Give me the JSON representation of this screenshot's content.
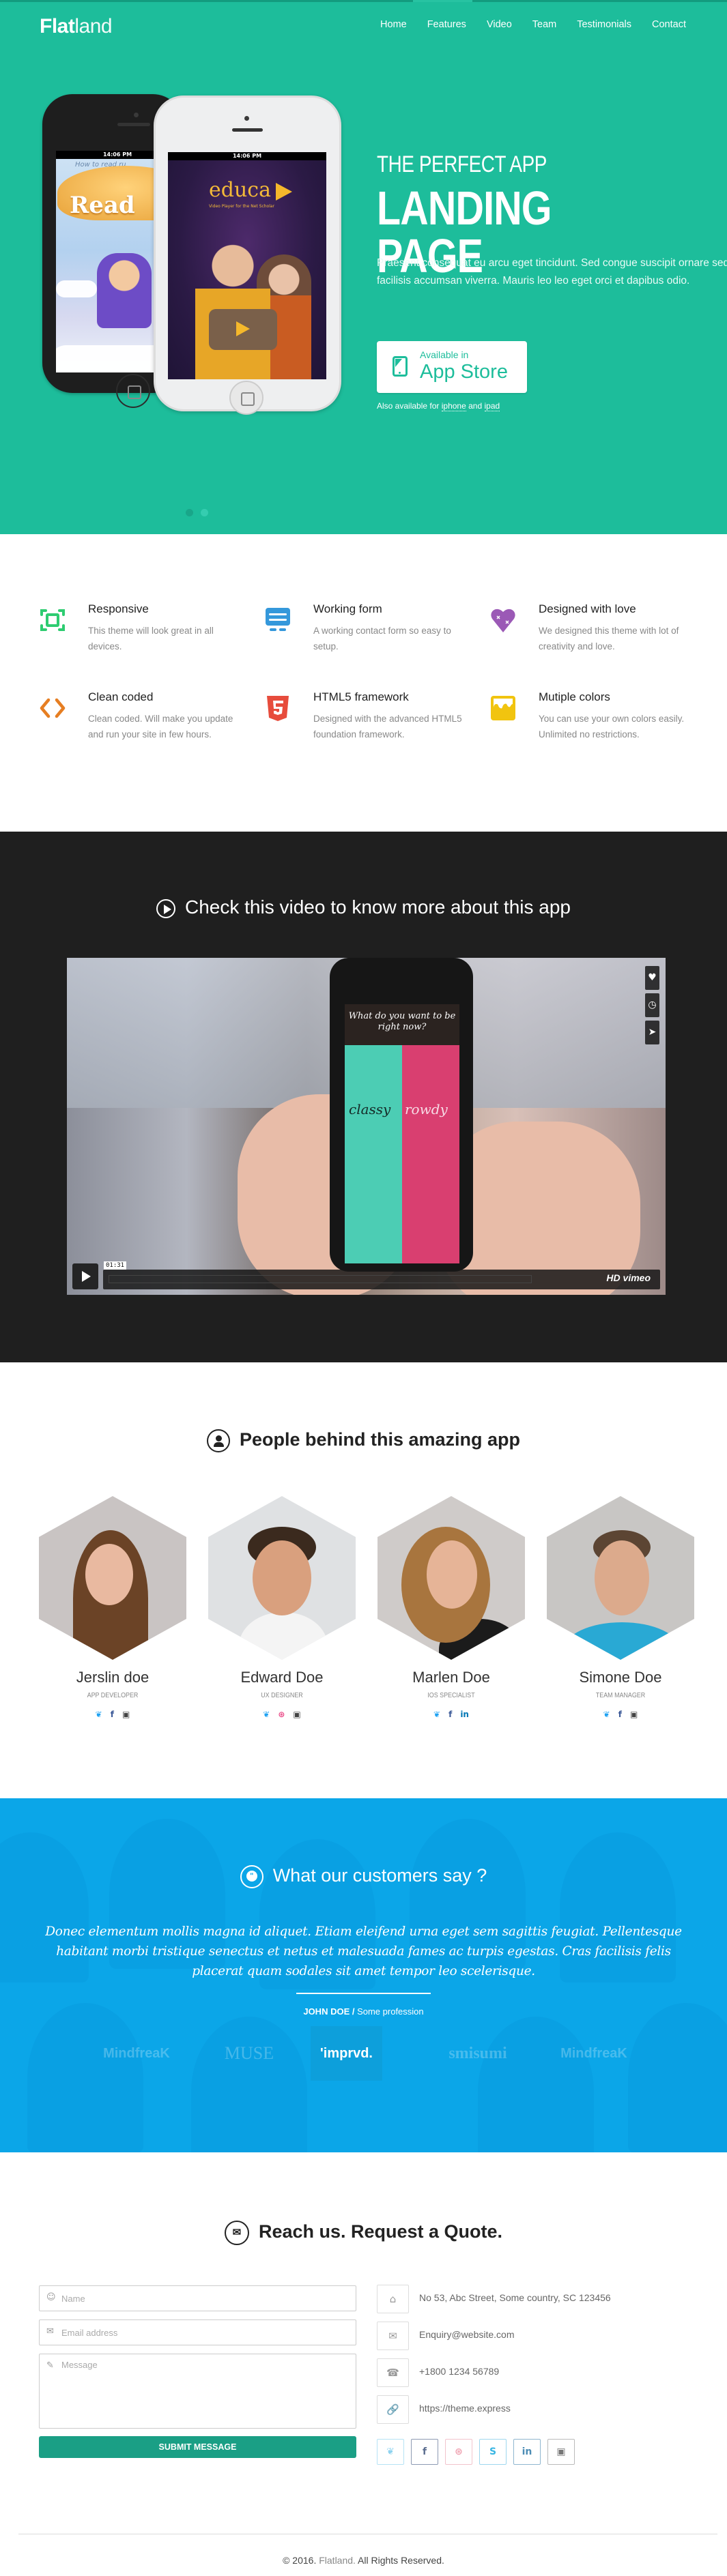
{
  "brand": {
    "bold": "Flat",
    "light": "land"
  },
  "nav": [
    {
      "label": "Home"
    },
    {
      "label": "Features"
    },
    {
      "label": "Video"
    },
    {
      "label": "Team"
    },
    {
      "label": "Testimonials"
    },
    {
      "label": "Contact"
    }
  ],
  "colors": {
    "primary": "#1dbd9b",
    "dark_section": "#1f1f1f",
    "testimonial_blue": "#0ba6e8",
    "submit": "#1a9f85"
  },
  "hero": {
    "subtitle": "THE PERFECT APP",
    "title": "LANDING PAGE",
    "text": "Praesent consequat eu arcu eget tincidunt. Sed congue suscipit ornare sed facilisis accumsan viverra. Mauris leo leo eget orci et dapibus odio.",
    "appstore_small": "Available in",
    "appstore_big": "App Store",
    "also_prefix": "Also available for",
    "also_link1": "iphone",
    "also_mid": "and",
    "also_link2": "ipad",
    "phone_time": "14:06 PM",
    "phone_left_hint": "How to read ru",
    "phone_left_title": "Read",
    "phone_right_title": "educa",
    "phone_right_sub": "Video Player for the Net Scholar",
    "slider": {
      "count": 2,
      "active": 2
    }
  },
  "features": [
    {
      "icon": "responsive-icon",
      "color": "#2ecc71",
      "title": "Responsive",
      "text": "This theme will look great in all devices."
    },
    {
      "icon": "form-icon",
      "color": "#3498db",
      "title": "Working form",
      "text": "A working contact form so easy to setup."
    },
    {
      "icon": "heart-icon",
      "color": "#9b59b6",
      "title": "Designed with love",
      "text": "We designed this theme with lot of creativity and love."
    },
    {
      "icon": "code-icon",
      "color": "#e67e22",
      "title": "Clean coded",
      "text": "Clean coded. Will make you update and run your site in few hours."
    },
    {
      "icon": "html5-icon",
      "color": "#e74c3c",
      "title": "HTML5 framework",
      "text": "Designed with the advanced HTML5 foundation framework."
    },
    {
      "icon": "paint-icon",
      "color": "#f1c40f",
      "title": "Mutiple colors",
      "text": "You can use your own colors easily. Unlimited no restrictions."
    }
  ],
  "video": {
    "heading": "Check this video to know more about this app",
    "question": "What do you want to be right now?",
    "left_option": "classy",
    "right_option": "rowdy",
    "time": "01:31",
    "brand": "HD vimeo",
    "side_buttons": [
      {
        "icon": "heart-icon",
        "glyph": "♥"
      },
      {
        "icon": "clock-icon",
        "glyph": "◷"
      },
      {
        "icon": "send-icon",
        "glyph": "➤"
      }
    ]
  },
  "team": {
    "heading": "People behind this amazing app",
    "members": [
      {
        "name": "Jerslin doe",
        "role": "APP DEVELOPER",
        "social": [
          {
            "icon": "twitter-icon",
            "glyph": "🐦",
            "color": "#1da1f2"
          },
          {
            "icon": "facebook-icon",
            "glyph": "f",
            "color": "#3b5998"
          },
          {
            "icon": "instagram-icon",
            "glyph": "▣",
            "color": "#444"
          }
        ],
        "bg": "#c9c4c3",
        "skin": "#e9b9a0",
        "hair": "#6b4326",
        "shirt": "#8c8a88"
      },
      {
        "name": "Edward Doe",
        "role": "UX DESIGNER",
        "social": [
          {
            "icon": "twitter-icon",
            "glyph": "🐦",
            "color": "#1da1f2"
          },
          {
            "icon": "dribbble-icon",
            "glyph": "⊛",
            "color": "#ea4c89"
          },
          {
            "icon": "instagram-icon",
            "glyph": "▣",
            "color": "#444"
          }
        ],
        "bg": "#dfe1e3",
        "skin": "#d9a07e",
        "hair": "#3b2a1e",
        "shirt": "#f4f4f4"
      },
      {
        "name": "Marlen Doe",
        "role": "IOS SPECIALIST",
        "social": [
          {
            "icon": "twitter-icon",
            "glyph": "🐦",
            "color": "#1da1f2"
          },
          {
            "icon": "facebook-icon",
            "glyph": "f",
            "color": "#3b5998"
          },
          {
            "icon": "linkedin-icon",
            "glyph": "in",
            "color": "#0077b5"
          }
        ],
        "bg": "#cfcbc9",
        "skin": "#e6b497",
        "hair": "#a8753e",
        "shirt": "#1b1b1b"
      },
      {
        "name": "Simone Doe",
        "role": "TEAM MANAGER",
        "social": [
          {
            "icon": "twitter-icon",
            "glyph": "🐦",
            "color": "#1da1f2"
          },
          {
            "icon": "facebook-icon",
            "glyph": "f",
            "color": "#3b5998"
          },
          {
            "icon": "instagram-icon",
            "glyph": "▣",
            "color": "#444"
          }
        ],
        "bg": "#c8c6c4",
        "skin": "#dcaa8c",
        "hair": "#5c4533",
        "shirt": "#29a9d4"
      }
    ]
  },
  "testimonials": {
    "heading": "What our customers say ?",
    "quote": "Donec elementum mollis magna id aliquet. Etiam eleifend urna eget sem sagittis feugiat. Pellentesque habitant morbi tristique senectus et netus et malesuada fames ac turpis egestas. Cras facilisis felis placerat quam sodales sit amet tempor leo scelerisque.",
    "author": "JOHN DOE /",
    "profession": " Some profession",
    "logos": [
      {
        "label": "MindfreaK",
        "active": false
      },
      {
        "label": "MUSE",
        "active": false
      },
      {
        "label": "'imprvd.",
        "active": true
      },
      {
        "label": "smisumi",
        "active": false
      },
      {
        "label": "MindfreaK",
        "active": false
      }
    ]
  },
  "contact": {
    "heading": "Reach us. Request a Quote.",
    "name_placeholder": "Name",
    "email_placeholder": "Email address",
    "message_placeholder": "Message",
    "submit_label": "SUBMIT MESSAGE",
    "info": [
      {
        "icon": "home-icon",
        "glyph": "⌂",
        "text": "No 53, Abc Street, Some country, SC 123456"
      },
      {
        "icon": "mail-icon",
        "glyph": "✉",
        "text": "Enquiry@website.com"
      },
      {
        "icon": "phone-icon",
        "glyph": "☎",
        "text": "+1800 1234 56789"
      },
      {
        "icon": "link-icon",
        "glyph": "🔗",
        "text": "https://theme.express"
      }
    ],
    "social": [
      {
        "icon": "twitter-icon",
        "glyph": "🐦",
        "color": "#8fd3f0"
      },
      {
        "icon": "facebook-icon",
        "glyph": "f",
        "color": "#5b6d8f"
      },
      {
        "icon": "dribbble-icon",
        "glyph": "⊛",
        "color": "#f0a5b4"
      },
      {
        "icon": "skype-icon",
        "glyph": "S",
        "color": "#37b5e3"
      },
      {
        "icon": "linkedin-icon",
        "glyph": "in",
        "color": "#4d8db5"
      },
      {
        "icon": "instagram-icon",
        "glyph": "▣",
        "color": "#777"
      }
    ]
  },
  "footer": {
    "prefix": "© 2016. ",
    "brand": "Flatland.",
    "suffix": " All Rights Reserved."
  }
}
